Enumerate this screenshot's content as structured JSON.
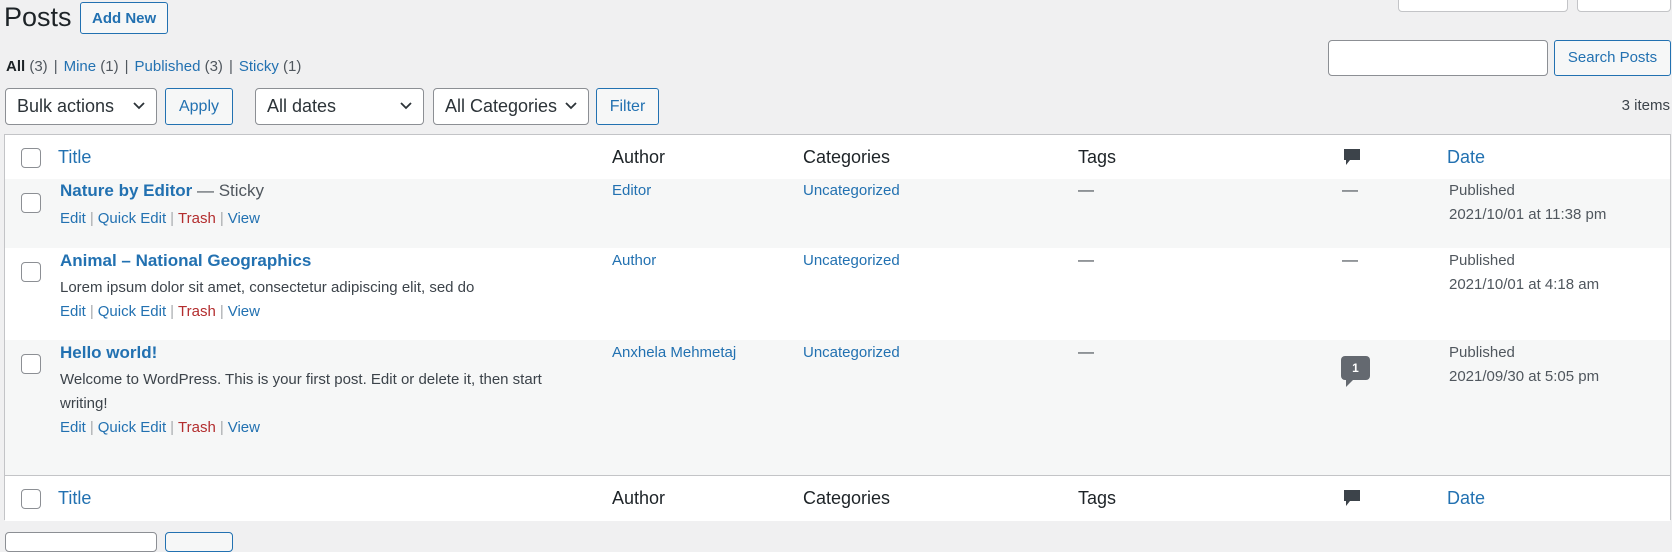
{
  "header": {
    "title": "Posts",
    "add_new_label": "Add New"
  },
  "views": [
    {
      "label": "All",
      "count": "(3)",
      "current": true
    },
    {
      "label": "Mine",
      "count": "(1)"
    },
    {
      "label": "Published",
      "count": "(3)"
    },
    {
      "label": "Sticky",
      "count": "(1)"
    }
  ],
  "search": {
    "placeholder": "",
    "value": "",
    "button_label": "Search Posts"
  },
  "filters": {
    "bulk_actions": "Bulk actions",
    "apply_label": "Apply",
    "dates": "All dates",
    "categories": "All Categories",
    "filter_label": "Filter",
    "items_count": "3 items"
  },
  "columns": {
    "title": "Title",
    "author": "Author",
    "categories": "Categories",
    "tags": "Tags",
    "comments_icon": "comment-icon",
    "date": "Date"
  },
  "row_actions": {
    "edit": "Edit",
    "quick_edit": "Quick Edit",
    "trash": "Trash",
    "view": "View"
  },
  "posts": [
    {
      "title": "Nature by Editor",
      "state": " — Sticky",
      "excerpt": "",
      "author": "Editor",
      "category": "Uncategorized",
      "tags": "—",
      "comments": "—",
      "status": "Published",
      "date": "2021/10/01 at 11:38 pm"
    },
    {
      "title": "Animal – National Geographics",
      "state": "",
      "excerpt": "Lorem ipsum dolor sit amet, consectetur adipiscing elit, sed do",
      "author": "Author",
      "category": "Uncategorized",
      "tags": "—",
      "comments": "—",
      "status": "Published",
      "date": "2021/10/01 at 4:18 am"
    },
    {
      "title": "Hello world!",
      "state": "",
      "excerpt": "Welcome to WordPress. This is your first post. Edit or delete it, then start writing!",
      "author": "Anxhela Mehmetaj",
      "category": "Uncategorized",
      "tags": "—",
      "comments": "1",
      "status": "Published",
      "date": "2021/09/30 at 5:05 pm"
    }
  ],
  "colors": {
    "link": "#2271b1",
    "trash": "#b32d2e",
    "background": "#f0f0f1"
  }
}
